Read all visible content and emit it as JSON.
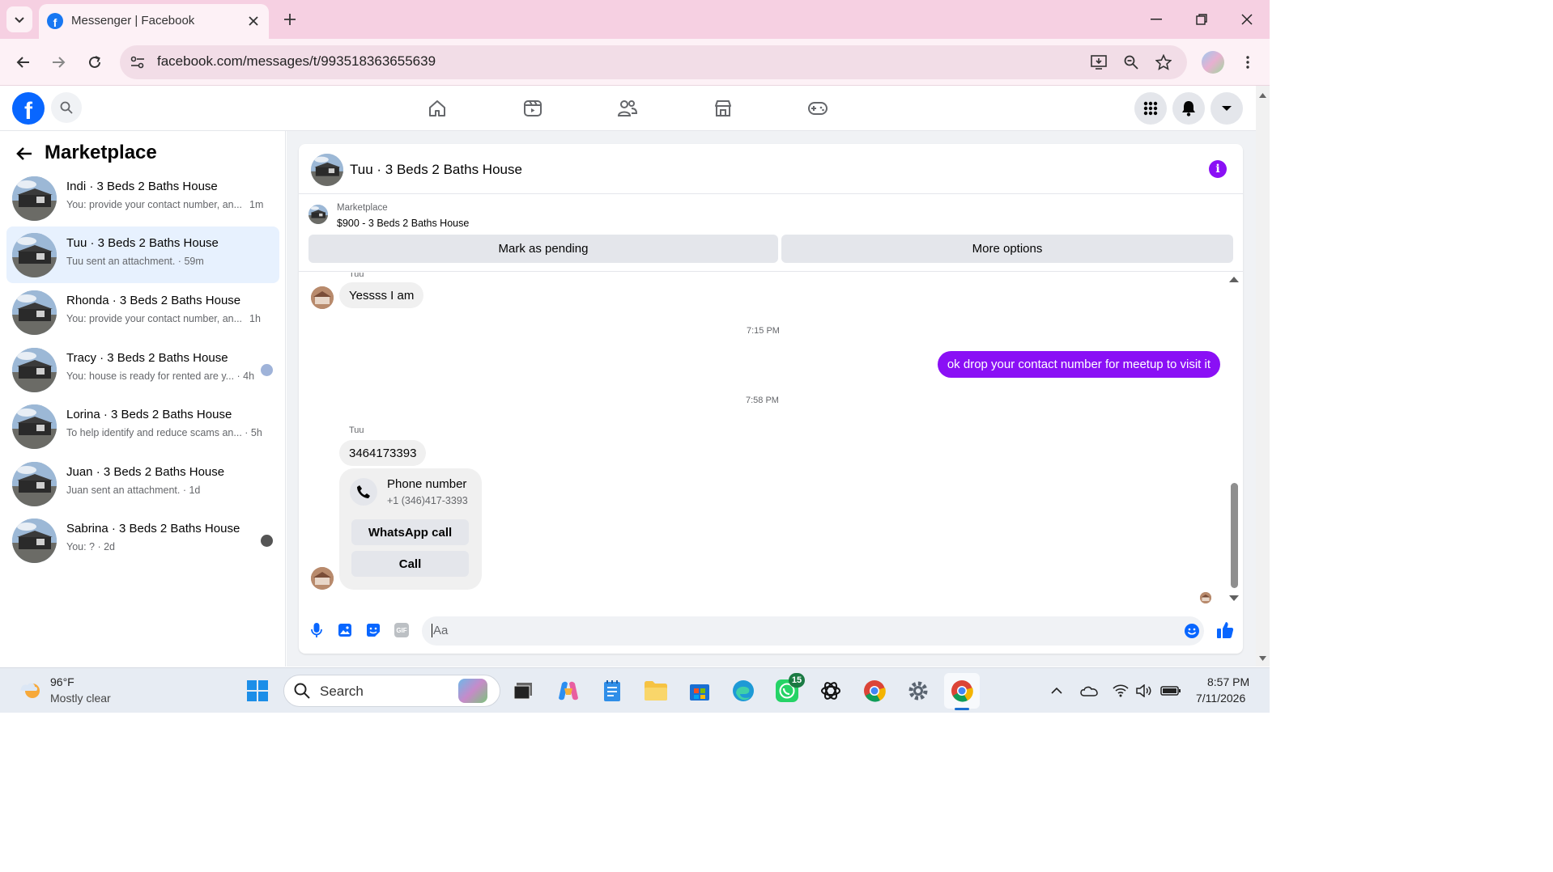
{
  "browser": {
    "tab_title": "Messenger | Facebook",
    "url": "facebook.com/messages/t/993518363655639",
    "icons": [
      "tab-search-icon",
      "facebook-favicon",
      "close-icon",
      "new-tab-icon",
      "minimize-icon",
      "restore-icon",
      "close-window-icon",
      "back-icon",
      "forward-icon",
      "reload-icon",
      "site-settings-icon",
      "install-app-icon",
      "zoom-icon",
      "bookmark-star-icon",
      "profile-avatar-icon",
      "menu-dots-icon"
    ]
  },
  "fb": {
    "nav_icons": [
      "home-icon",
      "video-icon",
      "friends-icon",
      "marketplace-icon",
      "gaming-icon"
    ],
    "right_icons": [
      "menu-grid-icon",
      "notifications-bell-icon",
      "account-dropdown-icon"
    ]
  },
  "sidebar": {
    "title": "Marketplace",
    "conversations": [
      {
        "name": "Indi · 3 Beds 2 Baths House",
        "preview": "You: provide your contact number, an...",
        "time": "1m",
        "active": false
      },
      {
        "name": "Tuu · 3 Beds 2 Baths House",
        "preview": "Tuu sent an attachment. · 59m",
        "time": "",
        "active": true
      },
      {
        "name": "Rhonda · 3 Beds 2 Baths House",
        "preview": "You: provide your contact number, an...",
        "time": "1h",
        "active": false
      },
      {
        "name": "Tracy · 3 Beds 2 Baths House",
        "preview": "You: house is ready for rented are y... · 4h",
        "time": "",
        "active": false
      },
      {
        "name": "Lorina · 3 Beds 2 Baths House",
        "preview": "To help identify and reduce scams an... · 5h",
        "time": "",
        "active": false
      },
      {
        "name": "Juan · 3 Beds 2 Baths House",
        "preview": "Juan sent an attachment. · 1d",
        "time": "",
        "active": false
      },
      {
        "name": "Sabrina · 3 Beds 2 Baths House",
        "preview": "You: ? · 2d",
        "time": "",
        "active": false
      }
    ]
  },
  "chat": {
    "title": "Tuu · 3 Beds 2 Baths House",
    "listing_label": "Marketplace",
    "listing_title": "$900 - 3 Beds 2 Baths House",
    "mark_pending": "Mark as pending",
    "more_options": "More options",
    "sender_label_top": "Tuu",
    "msg1": "Yessss I am",
    "time1": "7:15 PM",
    "msg2": "ok drop your contact number for meetup to visit it",
    "time2": "7:58 PM",
    "sender_label": "Tuu",
    "msg3": "3464173393",
    "phone_card_title": "Phone number",
    "phone_card_number": "+1 (346)417-3393",
    "whatsapp_call": "WhatsApp call",
    "call": "Call",
    "composer_placeholder": "Aa",
    "composer_icons": [
      "microphone-icon",
      "photo-icon",
      "sticker-icon",
      "gif-icon",
      "emoji-icon",
      "like-thumb-icon"
    ],
    "accent_color": "#8a10f5"
  },
  "taskbar": {
    "weather_temp": "96°F",
    "weather_desc": "Mostly clear",
    "search_label": "Search",
    "whatsapp_badge": "15",
    "time": "8:57 PM",
    "date": "7/11/2026"
  }
}
